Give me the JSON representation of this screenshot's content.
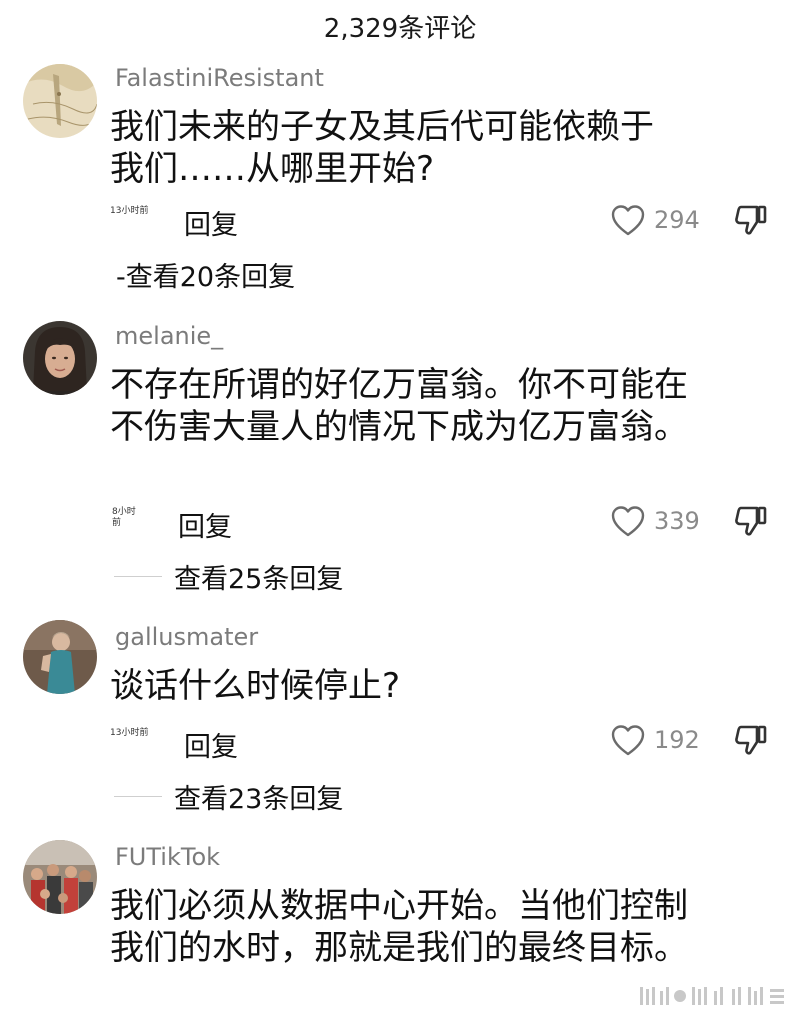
{
  "header": {
    "title": "2,329条评论"
  },
  "comments": [
    {
      "username": "FalastiniResistant",
      "text_lines": [
        "我们未来的子女及其后代可能依赖于",
        "我们……从哪里开始?"
      ],
      "time": "13小时前",
      "reply_label": "回复",
      "likes": "294",
      "view_replies": "-查看20条回复"
    },
    {
      "username": "melanie_",
      "text_lines": [
        "不存在所谓的好亿万富翁。你不可能在",
        "不伤害大量人的情况下成为亿万富翁。"
      ],
      "time_lines": [
        "8小时",
        "前"
      ],
      "reply_label": "回复",
      "likes": "339",
      "view_replies": "查看25条回复"
    },
    {
      "username": "gallusmater",
      "text_lines": [
        "谈话什么时候停止?"
      ],
      "time": "13小时前",
      "reply_label": "回复",
      "likes": "192",
      "view_replies": "查看23条回复"
    },
    {
      "username": "FUTikTok",
      "text_lines": [
        "我们必须从数据中心开始。当他们控制",
        "我们的水时，那就是我们的最终目标。"
      ]
    }
  ],
  "icons": {
    "like": "heart-outline-icon",
    "dislike": "thumbs-down-icon"
  },
  "colors": {
    "username": "#7b7b7b",
    "like_count": "#8a8a8a",
    "text": "#111111"
  }
}
